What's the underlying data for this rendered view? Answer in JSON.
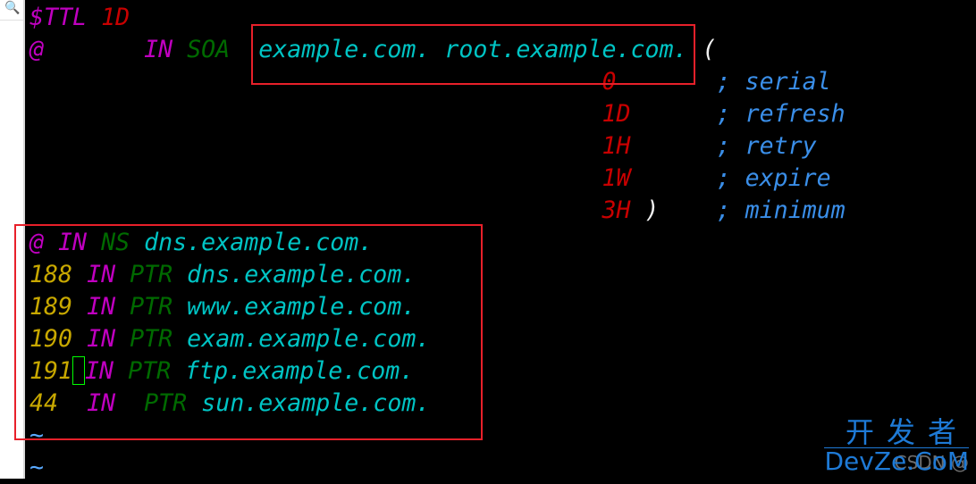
{
  "sidebar": {
    "icon": "search-icon"
  },
  "colors": {
    "keyword": "#c000c0",
    "ttl": "#c80000",
    "type": "#006a00",
    "domain": "#00c4c4",
    "number": "#c8a800",
    "comment": "#3a8ee8",
    "highlight_box": "#e8202a",
    "cursor": "#00ff00"
  },
  "lines": [
    [
      {
        "t": "$TTL",
        "c": "mag"
      },
      {
        "t": " "
      },
      {
        "t": "1D",
        "c": "red"
      }
    ],
    [
      {
        "t": "@",
        "c": "mag"
      },
      {
        "t": "       "
      },
      {
        "t": "IN",
        "c": "mag"
      },
      {
        "t": " "
      },
      {
        "t": "SOA",
        "c": "grn"
      },
      {
        "t": "  "
      },
      {
        "t": "example.com. root.example.com.",
        "c": "cyn"
      },
      {
        "t": " "
      },
      {
        "t": "(",
        "c": "wht"
      }
    ],
    [
      {
        "t": "                                        "
      },
      {
        "t": "0",
        "c": "red"
      },
      {
        "t": "       "
      },
      {
        "t": "; serial",
        "c": "blu"
      }
    ],
    [
      {
        "t": "                                        "
      },
      {
        "t": "1D",
        "c": "red"
      },
      {
        "t": "      "
      },
      {
        "t": "; refresh",
        "c": "blu"
      }
    ],
    [
      {
        "t": "                                        "
      },
      {
        "t": "1H",
        "c": "red"
      },
      {
        "t": "      "
      },
      {
        "t": "; retry",
        "c": "blu"
      }
    ],
    [
      {
        "t": "                                        "
      },
      {
        "t": "1W",
        "c": "red"
      },
      {
        "t": "      "
      },
      {
        "t": "; expire",
        "c": "blu"
      }
    ],
    [
      {
        "t": "                                        "
      },
      {
        "t": "3H",
        "c": "red"
      },
      {
        "t": " "
      },
      {
        "t": ")",
        "c": "wht"
      },
      {
        "t": "    "
      },
      {
        "t": "; minimum",
        "c": "blu"
      }
    ],
    [
      {
        "t": "@",
        "c": "mag"
      },
      {
        "t": " "
      },
      {
        "t": "IN",
        "c": "mag"
      },
      {
        "t": " "
      },
      {
        "t": "NS",
        "c": "grn"
      },
      {
        "t": " "
      },
      {
        "t": "dns.example.com.",
        "c": "cyn"
      }
    ],
    [
      {
        "t": "188",
        "c": "yel"
      },
      {
        "t": " "
      },
      {
        "t": "IN",
        "c": "mag"
      },
      {
        "t": " "
      },
      {
        "t": "PTR",
        "c": "grn"
      },
      {
        "t": " "
      },
      {
        "t": "dns.example.com.",
        "c": "cyn"
      }
    ],
    [
      {
        "t": "189",
        "c": "yel"
      },
      {
        "t": " "
      },
      {
        "t": "IN",
        "c": "mag"
      },
      {
        "t": " "
      },
      {
        "t": "PTR",
        "c": "grn"
      },
      {
        "t": " "
      },
      {
        "t": "www.example.com.",
        "c": "cyn"
      }
    ],
    [
      {
        "t": "190",
        "c": "yel"
      },
      {
        "t": " "
      },
      {
        "t": "IN",
        "c": "mag"
      },
      {
        "t": " "
      },
      {
        "t": "PTR",
        "c": "grn"
      },
      {
        "t": " "
      },
      {
        "t": "exam.example.com.",
        "c": "cyn"
      }
    ],
    [
      {
        "t": "191",
        "c": "yel"
      },
      {
        "t": "",
        "cursor": true
      },
      {
        "t": "IN",
        "c": "mag"
      },
      {
        "t": " "
      },
      {
        "t": "PTR",
        "c": "grn"
      },
      {
        "t": " "
      },
      {
        "t": "ftp.example.com.",
        "c": "cyn"
      }
    ],
    [
      {
        "t": "44",
        "c": "yel"
      },
      {
        "t": "  "
      },
      {
        "t": "IN",
        "c": "mag"
      },
      {
        "t": "  "
      },
      {
        "t": "PTR",
        "c": "grn"
      },
      {
        "t": " "
      },
      {
        "t": "sun.example.com.",
        "c": "cyn"
      }
    ],
    [
      {
        "t": "~",
        "c": "tld"
      }
    ],
    [
      {
        "t": "~",
        "c": "tld"
      }
    ]
  ],
  "watermark": {
    "cn": "开发者",
    "en": "DevZe.CoM",
    "csdn": "CSDN @"
  }
}
